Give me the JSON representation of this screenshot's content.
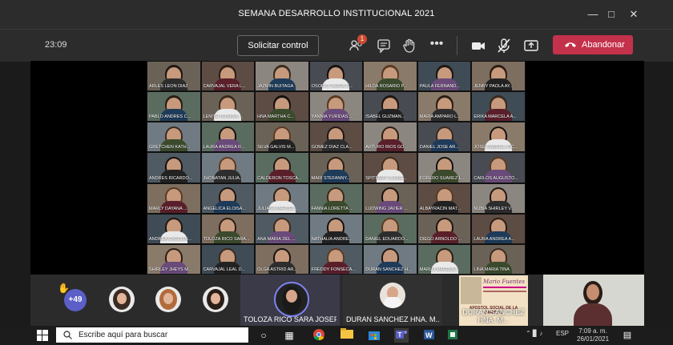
{
  "window": {
    "title": "SEMANA DESARROLLO INSTITUCIONAL 2021"
  },
  "toolbar": {
    "timer": "23:09",
    "request_control": "Solicitar control",
    "participants_badge": "1",
    "leave": "Abandonar"
  },
  "grid": [
    [
      "ARLES LEON DIAZ",
      "CARVAJAL VERA L...",
      "JAZMIN BUITAGA",
      "OSORIO PARRA C...",
      "HILDA ROSARIO P...",
      "PAULA FERNAND...",
      "JENNY PAOLA AY..."
    ],
    [
      "PABLO ANDRES C...",
      "LENITH SUSANA ...",
      "HNA MARTHA C...",
      "YANNIA YURIDAS...",
      "ISABEL GUZMAN...",
      "MARIA AMPARO L...",
      "ERIKA MARCELA A..."
    ],
    [
      "GRETCHEN KATH...",
      "LAURA ANDREA R...",
      "SILVA GALVIS M...",
      "GOMEZ DIAZ CLA...",
      "ARTURO RIOS GO...",
      "DANIEL JOSE AR...",
      "JOSE GABRIEL RIC..."
    ],
    [
      "ANDRES RICARDO...",
      "JHONATAN JULIA...",
      "CALDERON TOSCA...",
      "MARI STEFANNY...",
      "SPITFANY CLEME...",
      "FORERO SUAREZ L...",
      "CARLOS AUGUSTO..."
    ],
    [
      "MARLY DAYANA ...",
      "ANGELICA ELOISA...",
      "JULIANA MARCEL...",
      "FANNIA LORETTA ...",
      "LUDWING JAVIER ...",
      "ALBAYRACIN MAT...",
      "NUBIA SHIRLEY V..."
    ],
    [
      "ANDREA CAROLIN...",
      "TOLOZA RICO SARA...",
      "ANA MARIA DEL ...",
      "NATHALIA ANDRE...",
      "DANIEL EDUARDO...",
      "DIEGO ARNOLDO ...",
      "LAURA ANDREA A..."
    ],
    [
      "SHIRLEY JHEYS M...",
      "CARVAJAL LEAL D...",
      "OLGA ASTRID AR...",
      "FREDDY FONSECA...",
      "DURAN SANCHEZ H...",
      "MARLU MARQUE...",
      "LINA MARIA TINA"
    ]
  ],
  "strip": {
    "more_count": "+49",
    "featured_1": "TOLOZA RICO SARA JOSEFA",
    "featured_2": "DURAN SANCHEZ HNA. M...",
    "featured_3": "DURAN SANCHEZ HNA. M..."
  },
  "flyer": {
    "line1": "Mario Fuentes",
    "line2": "APOSTOL SOCIAL DE LA CARIDAD"
  },
  "taskbar": {
    "search_placeholder": "Escribe aquí para buscar",
    "language": "ESP",
    "time": "7:09 a. m.",
    "date": "26/01/2021"
  },
  "colors": {
    "accent": "#5b5fc7",
    "leave": "#c4314b",
    "badge": "#cc4a31"
  }
}
